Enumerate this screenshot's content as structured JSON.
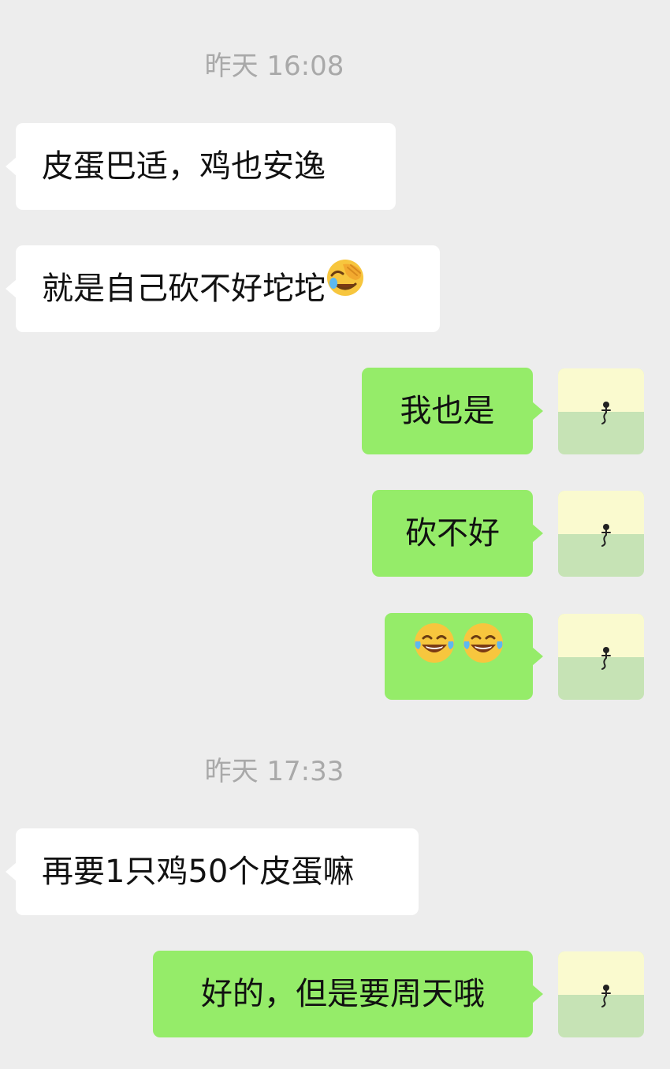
{
  "timestamps": [
    {
      "text": "昨天 16:08"
    },
    {
      "text": "昨天 17:33"
    }
  ],
  "messages": [
    {
      "side": "incoming",
      "text": "皮蛋巴适，鸡也安逸"
    },
    {
      "side": "incoming",
      "text": "就是自己砍不好坨坨",
      "emoji": "face-with-hand-over-eyes-icon"
    },
    {
      "side": "outgoing",
      "text": "我也是"
    },
    {
      "side": "outgoing",
      "text": "砍不好"
    },
    {
      "side": "outgoing",
      "emoji": "tears-of-joy-icon x2"
    },
    {
      "side": "incoming",
      "text": "再要1只鸡50个皮蛋嘛"
    },
    {
      "side": "outgoing",
      "text": "好的，但是要周天哦"
    }
  ],
  "avatar": {
    "icon": "figure-avatar-icon",
    "colors": {
      "top": "#fafacf",
      "bottom": "#c6e3b5"
    }
  },
  "colors": {
    "background": "#ededed",
    "incoming_bubble": "#ffffff",
    "outgoing_bubble": "#95ec69",
    "timestamp": "#a9a9a9",
    "text": "#111111"
  }
}
